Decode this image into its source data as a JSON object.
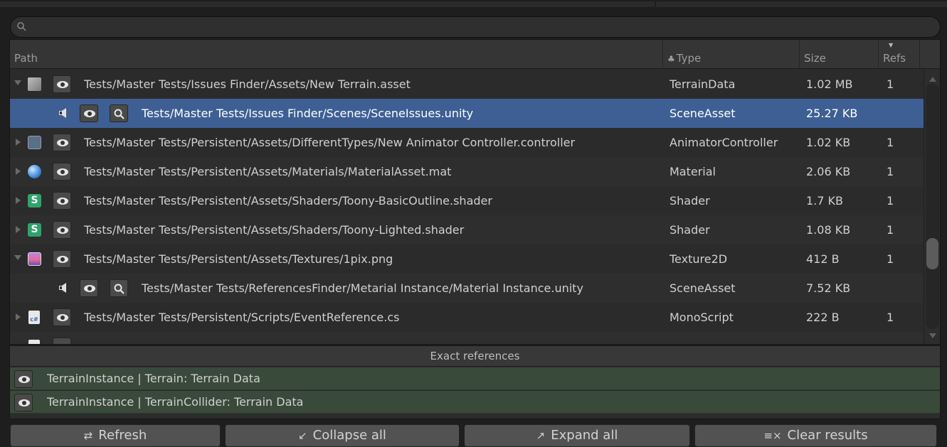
{
  "search": {
    "placeholder": ""
  },
  "columns": {
    "path": "Path",
    "type": "Type",
    "size": "Size",
    "refs": "Refs"
  },
  "rows": [
    {
      "kind": "parent",
      "expanded": true,
      "icon": "terrain-icon",
      "path": "Tests/Master Tests/Issues Finder/Assets/New Terrain.asset",
      "type": "TerrainData",
      "size": "1.02 MB",
      "refs": "1"
    },
    {
      "kind": "child",
      "selected": true,
      "icon": "scene-icon",
      "path": "Tests/Master Tests/Issues Finder/Scenes/SceneIssues.unity",
      "type": "SceneAsset",
      "size": "25.27 KB",
      "refs": ""
    },
    {
      "kind": "parent",
      "expanded": false,
      "icon": "animator-controller-icon",
      "path": "Tests/Master Tests/Persistent/Assets/DifferentTypes/New Animator Controller.controller",
      "type": "AnimatorController",
      "size": "1.02 KB",
      "refs": "1"
    },
    {
      "kind": "parent",
      "expanded": false,
      "icon": "material-icon",
      "path": "Tests/Master Tests/Persistent/Assets/Materials/MaterialAsset.mat",
      "type": "Material",
      "size": "2.06 KB",
      "refs": "1"
    },
    {
      "kind": "parent",
      "expanded": false,
      "icon": "shader-icon",
      "path": "Tests/Master Tests/Persistent/Assets/Shaders/Toony-BasicOutline.shader",
      "type": "Shader",
      "size": "1.7 KB",
      "refs": "1"
    },
    {
      "kind": "parent",
      "expanded": false,
      "icon": "shader-icon",
      "path": "Tests/Master Tests/Persistent/Assets/Shaders/Toony-Lighted.shader",
      "type": "Shader",
      "size": "1.08 KB",
      "refs": "1"
    },
    {
      "kind": "parent",
      "expanded": true,
      "icon": "texture-icon",
      "path": "Tests/Master Tests/Persistent/Assets/Textures/1pix.png",
      "type": "Texture2D",
      "size": "412 B",
      "refs": "1"
    },
    {
      "kind": "child",
      "selected": false,
      "icon": "scene-icon",
      "path": "Tests/Master Tests/ReferencesFinder/Metarial Instance/Material Instance.unity",
      "type": "SceneAsset",
      "size": "7.52 KB",
      "refs": ""
    },
    {
      "kind": "parent",
      "expanded": false,
      "icon": "csharp-script-icon",
      "path": "Tests/Master Tests/Persistent/Scripts/EventReference.cs",
      "type": "MonoScript",
      "size": "222 B",
      "refs": "1"
    }
  ],
  "exact": {
    "title": "Exact references",
    "items": [
      "TerrainInstance | Terrain: Terrain Data",
      "TerrainInstance | TerrainCollider: Terrain Data"
    ]
  },
  "toolbar": {
    "refresh": "Refresh",
    "collapse_all": "Collapse all",
    "expand_all": "Expand all",
    "clear_results": "Clear results"
  },
  "colors": {
    "selection": "#3e5f93",
    "exact_row": "#3a4a3a",
    "button": "#525252"
  }
}
